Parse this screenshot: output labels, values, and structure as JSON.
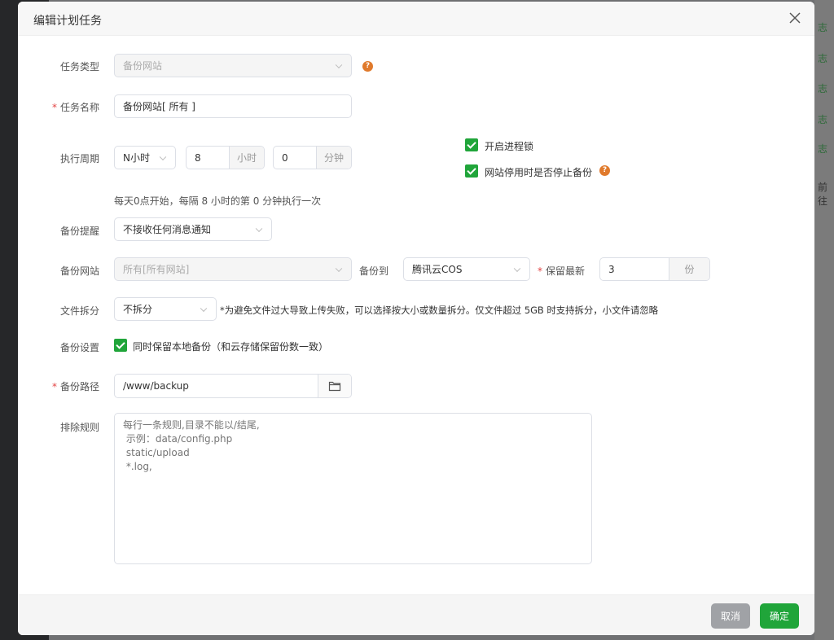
{
  "background": {
    "side_text": [
      "志",
      "志",
      "志",
      "志",
      "志"
    ],
    "goto_text": "前往"
  },
  "dialog": {
    "title": "编辑计划任务"
  },
  "form": {
    "task_type": {
      "label": "任务类型",
      "value": "备份网站"
    },
    "task_name": {
      "label": "任务名称",
      "value": "备份网站[ 所有 ]"
    },
    "cycle": {
      "label": "执行周期",
      "type": "N小时",
      "hours": "8",
      "hours_unit": "小时",
      "minutes": "0",
      "minutes_unit": "分钟",
      "hint": "每天0点开始，每隔 8 小时的第 0 分钟执行一次"
    },
    "process_lock": {
      "label": "开启进程锁",
      "checked": true
    },
    "stop_on_disable": {
      "label": "网站停用时是否停止备份",
      "checked": true
    },
    "notify": {
      "label": "备份提醒",
      "value": "不接收任何消息通知"
    },
    "site": {
      "label": "备份网站",
      "value": "所有[所有网站]"
    },
    "backup_to": {
      "label": "备份到",
      "value": "腾讯云COS"
    },
    "keep": {
      "label": "保留最新",
      "value": "3",
      "unit": "份"
    },
    "split": {
      "label": "文件拆分",
      "value": "不拆分",
      "note": "*为避免文件过大导致上传失败，可以选择按大小或数量拆分。仅文件超过 5GB 时支持拆分，小文件请忽略"
    },
    "settings": {
      "label": "备份设置",
      "keep_local": "同时保留本地备份（和云存储保留份数一致）",
      "checked": true
    },
    "path": {
      "label": "备份路径",
      "value": "/www/backup"
    },
    "exclude": {
      "label": "排除规则",
      "placeholder": "每行一条规则,目录不能以/结尾,\n 示例：data/config.php\n static/upload\n *.log,"
    }
  },
  "footer": {
    "cancel": "取消",
    "confirm": "确定"
  },
  "colors": {
    "accent": "#20a53a",
    "help": "#e07a2c",
    "cancel": "#a0a2a6"
  }
}
